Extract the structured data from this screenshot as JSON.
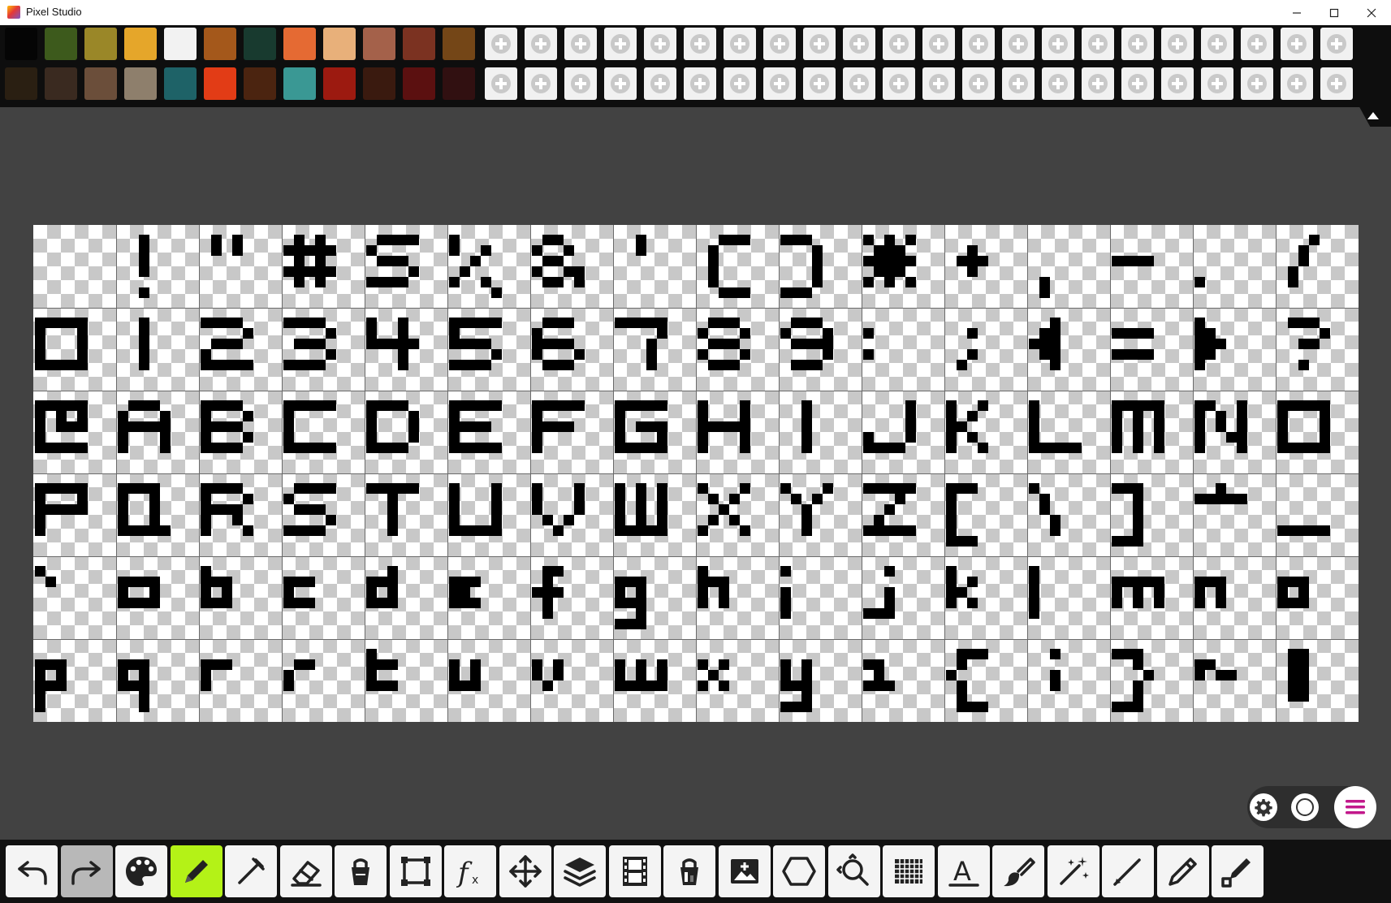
{
  "window": {
    "title": "Pixel Studio"
  },
  "palette": {
    "row1": [
      "#050505",
      "#3d5a1c",
      "#9a8728",
      "#e5a62a",
      "#f2f2f2",
      "#a4581b",
      "#183a2f",
      "#e56a33",
      "#e8b07a",
      "#a4614a",
      "#7b3221",
      "#744617"
    ],
    "row2": [
      "#2a1f12",
      "#3a2a20",
      "#6b4e3a",
      "#8e7f6c",
      "#1e6267",
      "#e23c16",
      "#4b2410",
      "#3a9894",
      "#9c1a10",
      "#3a1a0f",
      "#5b1010",
      "#311011"
    ],
    "empty_slots_per_row": 23
  },
  "canvas": {
    "rows": [
      [
        " ",
        "!",
        "\"",
        "#",
        "$",
        "%",
        "&",
        "'",
        "(",
        ")",
        "*",
        "+",
        ",",
        "-",
        ".",
        "/"
      ],
      [
        "0",
        "1",
        "2",
        "3",
        "4",
        "5",
        "6",
        "7",
        "8",
        "9",
        ":",
        ";",
        "<",
        "=",
        ">",
        "?"
      ],
      [
        "@",
        "A",
        "B",
        "C",
        "D",
        "E",
        "F",
        "G",
        "H",
        "I",
        "J",
        "K",
        "L",
        "M",
        "N",
        "O"
      ],
      [
        "P",
        "Q",
        "R",
        "S",
        "T",
        "U",
        "V",
        "W",
        "X",
        "Y",
        "Z",
        "[",
        "\\",
        "]",
        "^",
        "_"
      ],
      [
        "`",
        "a",
        "b",
        "c",
        "d",
        "e",
        "f",
        "g",
        "h",
        "i",
        "j",
        "k",
        "l",
        "m",
        "n",
        "o"
      ],
      [
        "p",
        "q",
        "r",
        "s",
        "t",
        "u",
        "v",
        "w",
        "x",
        "y",
        "z",
        "{",
        "|",
        "}",
        "~",
        "▌"
      ]
    ],
    "glyph_color": "#000000"
  },
  "floating": {
    "settings": "gear-icon",
    "color": "circle-icon",
    "menu": "menu-icon",
    "menu_accent": "#c2188b"
  },
  "toolbar": {
    "accent": "#b4f217",
    "tools": [
      {
        "name": "undo",
        "icon": "undo-icon",
        "active": false,
        "disabled": false
      },
      {
        "name": "redo",
        "icon": "redo-icon",
        "active": false,
        "disabled": true
      },
      {
        "name": "palette",
        "icon": "palette-icon",
        "active": false,
        "disabled": false
      },
      {
        "name": "pencil",
        "icon": "pencil-icon",
        "active": true,
        "disabled": false
      },
      {
        "name": "eyedropper",
        "icon": "eyedropper-icon",
        "active": false,
        "disabled": false
      },
      {
        "name": "eraser",
        "icon": "eraser-icon",
        "active": false,
        "disabled": false
      },
      {
        "name": "fill",
        "icon": "bucket-icon",
        "active": false,
        "disabled": false
      },
      {
        "name": "select",
        "icon": "select-icon",
        "active": false,
        "disabled": false
      },
      {
        "name": "effects",
        "icon": "fx-icon",
        "active": false,
        "disabled": false
      },
      {
        "name": "move",
        "icon": "move-icon",
        "active": false,
        "disabled": false
      },
      {
        "name": "layers",
        "icon": "layers-icon",
        "active": false,
        "disabled": false
      },
      {
        "name": "animation",
        "icon": "film-icon",
        "active": false,
        "disabled": false
      },
      {
        "name": "gradient-fill",
        "icon": "bucket-gradient-icon",
        "active": false,
        "disabled": false
      },
      {
        "name": "add-image",
        "icon": "image-add-icon",
        "active": false,
        "disabled": false
      },
      {
        "name": "shapes",
        "icon": "hexagon-icon",
        "active": false,
        "disabled": false
      },
      {
        "name": "zoom",
        "icon": "zoom-icon",
        "active": false,
        "disabled": false
      },
      {
        "name": "grid",
        "icon": "grid-icon",
        "active": false,
        "disabled": false
      },
      {
        "name": "text",
        "icon": "text-icon",
        "active": false,
        "disabled": false
      },
      {
        "name": "brush",
        "icon": "brush-icon",
        "active": false,
        "disabled": false
      },
      {
        "name": "magic-wand",
        "icon": "wand-icon",
        "active": false,
        "disabled": false
      },
      {
        "name": "line",
        "icon": "line-icon",
        "active": false,
        "disabled": false
      },
      {
        "name": "pencil-2",
        "icon": "pen-icon",
        "active": false,
        "disabled": false
      },
      {
        "name": "pencil-3",
        "icon": "pen-square-icon",
        "active": false,
        "disabled": false
      }
    ]
  }
}
